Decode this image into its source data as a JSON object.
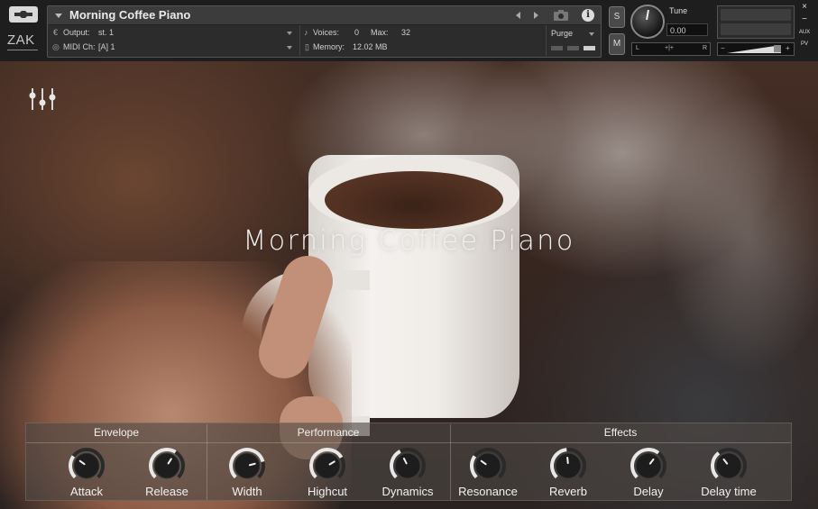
{
  "instrument": {
    "title": "Morning Coffee Piano",
    "output_label": "Output:",
    "output_value": "st. 1",
    "midi_label": "MIDI Ch:",
    "midi_value": "[A]  1",
    "voices_label": "Voices:",
    "voices_value": "0",
    "max_label": "Max:",
    "max_value": "32",
    "memory_label": "Memory:",
    "memory_value": "12.02 MB",
    "purge_label": "Purge"
  },
  "header": {
    "brand": "ZAK",
    "solo_label": "S",
    "mute_label": "M",
    "tune_label": "Tune",
    "tune_value": "0.00",
    "pan_left": "L",
    "pan_center": "+|+",
    "pan_right": "R",
    "vol_minus": "−",
    "vol_plus": "+",
    "close_label": "×",
    "minimize_label": "−",
    "aux_label": "AUX",
    "pv_label": "PV"
  },
  "main": {
    "title": "Morning Coffee Piano"
  },
  "groups": [
    {
      "name": "Envelope"
    },
    {
      "name": "Performance"
    },
    {
      "name": "Effects"
    }
  ],
  "knobs": [
    {
      "label": "Attack",
      "group": "Envelope",
      "value": 0.3
    },
    {
      "label": "Release",
      "group": "Envelope",
      "value": 0.62
    },
    {
      "label": "Width",
      "group": "Performance",
      "value": 0.78
    },
    {
      "label": "Highcut",
      "group": "Performance",
      "value": 0.72
    },
    {
      "label": "Dynamics",
      "group": "Performance",
      "value": 0.4
    },
    {
      "label": "Resonance",
      "group": "Effects",
      "value": 0.3
    },
    {
      "label": "Reverb",
      "group": "Effects",
      "value": 0.48
    },
    {
      "label": "Delay",
      "group": "Effects",
      "value": 0.64
    },
    {
      "label": "Delay time",
      "group": "Effects",
      "value": 0.36
    }
  ],
  "colors": {
    "panel_bg": "#1e1e1e",
    "knob_arc": "#e8e8e8",
    "knob_track": "#2a2a2a",
    "text_light": "#f0f0f0"
  }
}
